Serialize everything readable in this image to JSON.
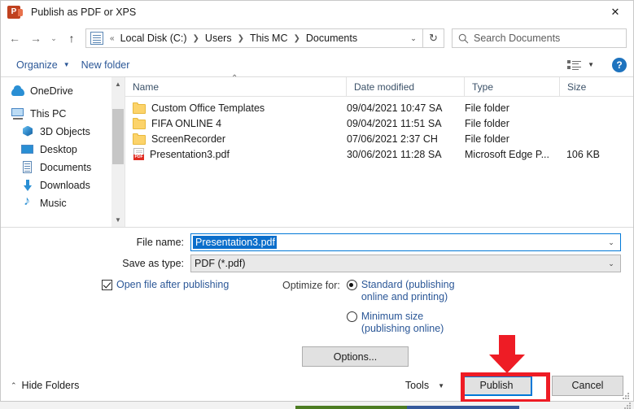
{
  "window": {
    "title": "Publish as PDF or XPS",
    "app_icon": "powerpoint-icon",
    "close_label": "✕"
  },
  "address_bar": {
    "back_label": "←",
    "forward_label": "→",
    "recent_label": "⌄",
    "up_label": "↑",
    "crumb_icon": "documents-folder-icon",
    "overflow_label": "«",
    "crumbs": [
      "Local Disk (C:)",
      "Users",
      "This MC",
      "Documents"
    ],
    "separator": "❯",
    "dropdown_label": "⌄",
    "refresh_label": "↻"
  },
  "search": {
    "icon": "search-icon",
    "placeholder": "Search Documents",
    "value": ""
  },
  "command_bar": {
    "organize_label": "Organize",
    "organize_caret": "▼",
    "new_folder_label": "New folder",
    "view_icon": "list-view-icon",
    "view_caret": "▼",
    "help_label": "?"
  },
  "nav_pane": {
    "items": [
      {
        "label": "OneDrive",
        "icon": "cloud-icon",
        "indent": false
      },
      {
        "label": "This PC",
        "icon": "monitor-icon",
        "indent": false
      },
      {
        "label": "3D Objects",
        "icon": "cube-icon",
        "indent": true
      },
      {
        "label": "Desktop",
        "icon": "desktop-icon",
        "indent": true
      },
      {
        "label": "Documents",
        "icon": "documents-icon",
        "indent": true
      },
      {
        "label": "Downloads",
        "icon": "download-arrow-icon",
        "indent": true
      },
      {
        "label": "Music",
        "icon": "music-note-icon",
        "indent": true
      }
    ],
    "scroll_up": "▲",
    "scroll_down": "▼"
  },
  "file_list": {
    "columns": [
      "Name",
      "Date modified",
      "Type",
      "Size"
    ],
    "sort_indicator": "⌃",
    "rows": [
      {
        "icon": "folder-icon",
        "name": "Custom Office Templates",
        "date": "09/04/2021 10:47 SA",
        "type": "File folder",
        "size": ""
      },
      {
        "icon": "folder-icon",
        "name": "FIFA ONLINE 4",
        "date": "09/04/2021 11:51 SA",
        "type": "File folder",
        "size": ""
      },
      {
        "icon": "folder-icon",
        "name": "ScreenRecorder",
        "date": "07/06/2021 2:37 CH",
        "type": "File folder",
        "size": ""
      },
      {
        "icon": "pdf-file-icon",
        "name": "Presentation3.pdf",
        "date": "30/06/2021 11:28 SA",
        "type": "Microsoft Edge P...",
        "size": "106 KB"
      }
    ]
  },
  "form": {
    "file_name_label": "File name:",
    "file_name_value": "Presentation3.pdf",
    "save_as_type_label": "Save as type:",
    "save_as_type_value": "PDF (*.pdf)",
    "combo_caret": "⌄",
    "open_after_publishing_label": "Open file after publishing",
    "open_after_publishing_checked": true,
    "optimize_for_label": "Optimize for:",
    "radio_options": [
      {
        "line1": "Standard (publishing",
        "line2": "online and printing)",
        "selected": true
      },
      {
        "line1": "Minimum size",
        "line2": "(publishing online)",
        "selected": false
      }
    ],
    "options_button_label": "Options..."
  },
  "footer": {
    "hide_folders_label": "Hide Folders",
    "hide_folders_chevron": "⌃",
    "tools_label": "Tools",
    "tools_caret": "▼",
    "publish_label": "Publish",
    "cancel_label": "Cancel"
  },
  "annotations": {
    "arrow_color": "#ee1c25",
    "highlight_color": "#ee1c25",
    "focus_color": "#0078d7",
    "arrow_target": "publish-button",
    "highlight_target": "publish-button"
  }
}
